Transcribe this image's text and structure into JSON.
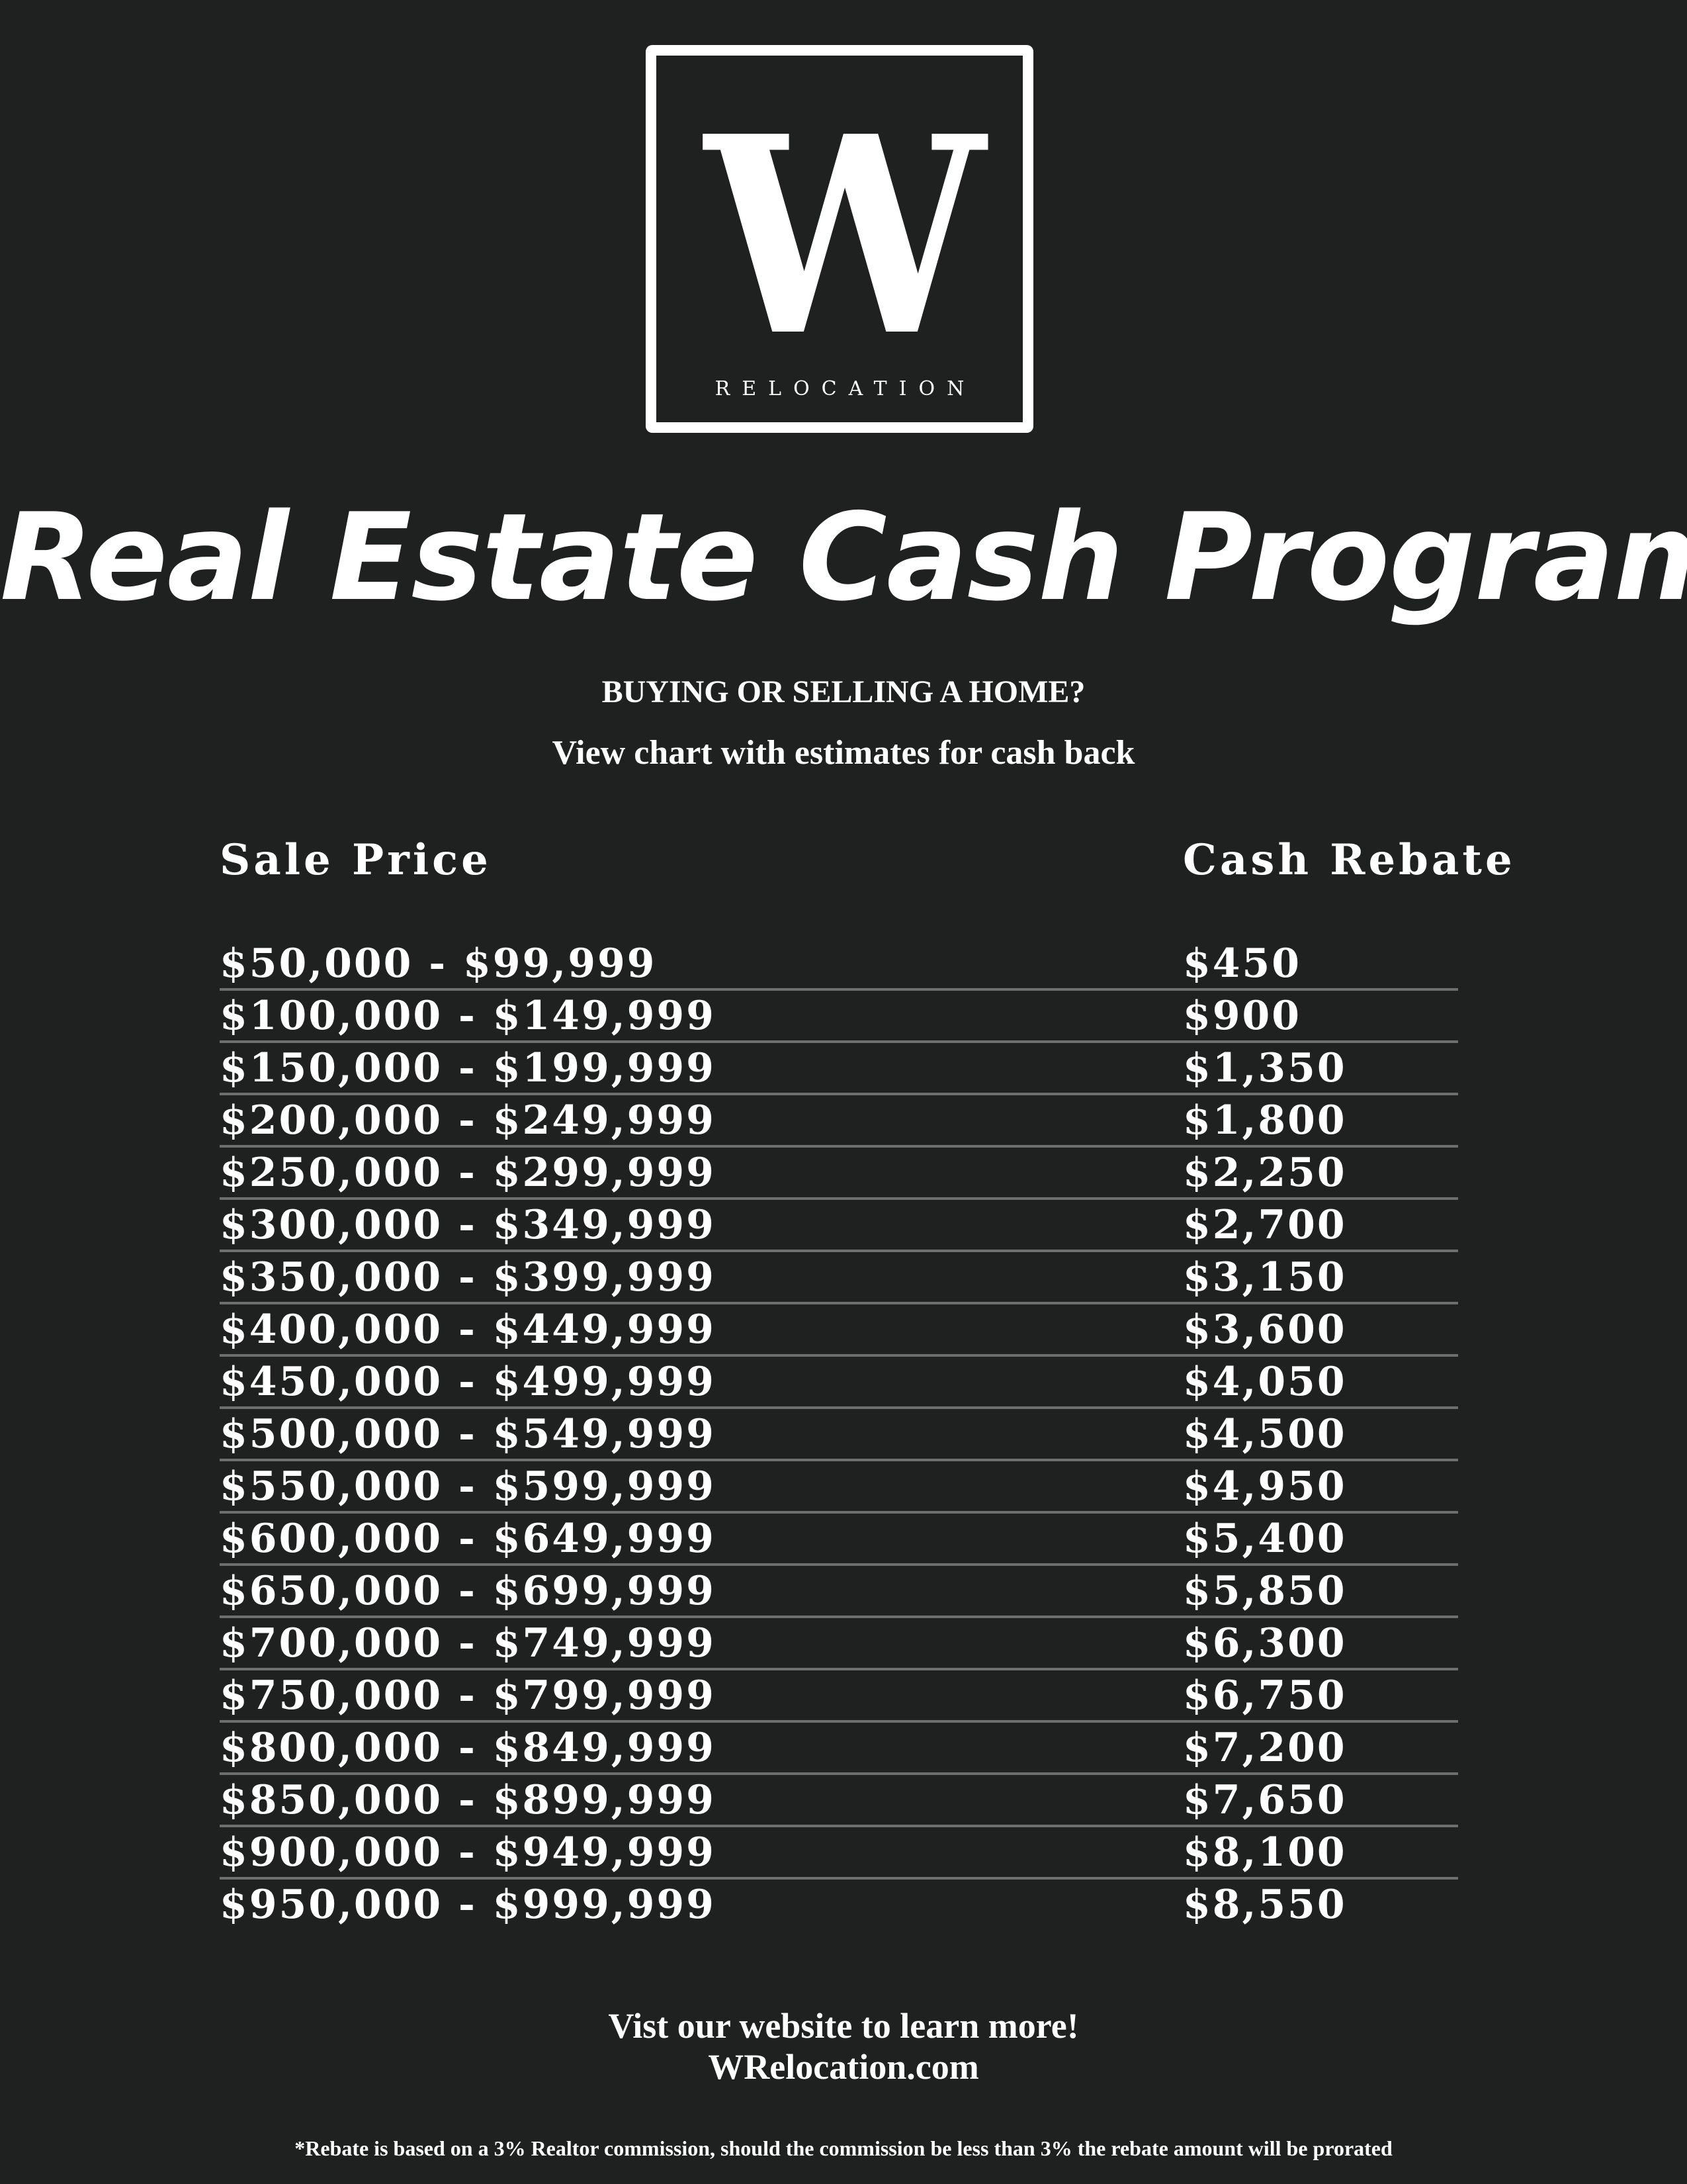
{
  "logo": {
    "mark": "W",
    "wordmark": "RELOCATION"
  },
  "title": "Real Estate Cash Program",
  "subtitle": {
    "line1": "BUYING OR SELLING A HOME?",
    "line2": "View chart with estimates for cash back"
  },
  "table": {
    "headers": {
      "price": "Sale Price",
      "rebate": "Cash Rebate"
    },
    "rows": [
      {
        "price": "$50,000 - $99,999",
        "rebate": "$450"
      },
      {
        "price": "$100,000 - $149,999",
        "rebate": "$900"
      },
      {
        "price": "$150,000 - $199,999",
        "rebate": "$1,350"
      },
      {
        "price": "$200,000 - $249,999",
        "rebate": "$1,800"
      },
      {
        "price": "$250,000 - $299,999",
        "rebate": "$2,250"
      },
      {
        "price": "$300,000 - $349,999",
        "rebate": "$2,700"
      },
      {
        "price": "$350,000 - $399,999",
        "rebate": "$3,150"
      },
      {
        "price": "$400,000 - $449,999",
        "rebate": "$3,600"
      },
      {
        "price": "$450,000 - $499,999",
        "rebate": "$4,050"
      },
      {
        "price": "$500,000 - $549,999",
        "rebate": "$4,500"
      },
      {
        "price": "$550,000 - $599,999",
        "rebate": "$4,950"
      },
      {
        "price": "$600,000 - $649,999",
        "rebate": "$5,400"
      },
      {
        "price": "$650,000 - $699,999",
        "rebate": "$5,850"
      },
      {
        "price": "$700,000 - $749,999",
        "rebate": "$6,300"
      },
      {
        "price": "$750,000 - $799,999",
        "rebate": "$6,750"
      },
      {
        "price": "$800,000 - $849,999",
        "rebate": "$7,200"
      },
      {
        "price": "$850,000 - $899,999",
        "rebate": "$7,650"
      },
      {
        "price": "$900,000 - $949,999",
        "rebate": "$8,100"
      },
      {
        "price": "$950,000 - $999,999",
        "rebate": "$8,550"
      }
    ]
  },
  "footer": {
    "line1": "Vist our website to learn more!",
    "line2": "WRelocation.com",
    "note": "*Rebate is based on a 3% Realtor commission, should the commission be less than 3% the rebate amount will be prorated"
  },
  "colors": {
    "background": "#1e2120",
    "text": "#ffffff",
    "divider": "#6d6f6e"
  }
}
